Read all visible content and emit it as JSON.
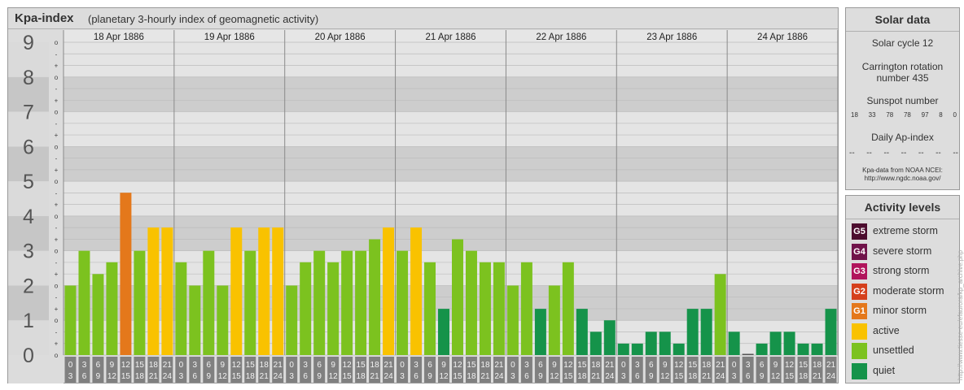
{
  "header": {
    "title": "Kpa-index",
    "subtitle": "(planetary 3-hourly index of geomagnetic activity)"
  },
  "chart_data": {
    "type": "bar",
    "title": "Kpa-index",
    "subtitle": "(planetary 3-hourly index of geomagnetic activity)",
    "ylim": [
      0,
      9
    ],
    "y_ticks": [
      "0",
      "1",
      "2",
      "3",
      "4",
      "5",
      "6",
      "7",
      "8",
      "9"
    ],
    "minor_tick_labels": [
      "o",
      "+",
      "-"
    ],
    "days": [
      "18 Apr 1886",
      "19 Apr 1886",
      "20 Apr 1886",
      "21 Apr 1886",
      "22 Apr 1886",
      "23 Apr 1886",
      "24 Apr 1886"
    ],
    "interval_start_labels": [
      "0",
      "3",
      "6",
      "9",
      "12",
      "15",
      "18",
      "21"
    ],
    "interval_end_labels": [
      "3",
      "6",
      "9",
      "12",
      "15",
      "18",
      "21",
      "24"
    ],
    "values": [
      [
        2.0,
        3.0,
        2.33,
        2.67,
        4.67,
        3.0,
        3.67,
        3.67
      ],
      [
        2.67,
        2.0,
        3.0,
        2.0,
        3.67,
        3.0,
        3.67,
        3.67
      ],
      [
        2.0,
        2.67,
        3.0,
        2.67,
        3.0,
        3.0,
        3.33,
        3.67
      ],
      [
        3.0,
        3.67,
        2.67,
        1.33,
        3.33,
        3.0,
        2.67,
        2.67
      ],
      [
        2.0,
        2.67,
        1.33,
        2.0,
        2.67,
        1.33,
        0.67,
        1.0
      ],
      [
        0.33,
        0.33,
        0.67,
        0.67,
        0.33,
        1.33,
        1.33,
        2.33
      ],
      [
        0.67,
        0.0,
        0.33,
        0.67,
        0.67,
        0.33,
        0.33,
        1.33
      ]
    ],
    "level_colors": {
      "quiet": "#15934a",
      "unsettled": "#7cc21f",
      "active": "#f9c200",
      "G1": "#e4781b",
      "G2": "#d5401c",
      "G3": "#b1145c",
      "G4": "#70134a",
      "G5": "#4c0c2e"
    }
  },
  "solar": {
    "heading": "Solar data",
    "cycle": "Solar cycle 12",
    "rotation_line1": "Carrington rotation",
    "rotation_line2": "number 435",
    "sunspot_label": "Sunspot number",
    "sunspot_values": [
      "18",
      "33",
      "78",
      "78",
      "97",
      "8",
      "0"
    ],
    "ap_label": "Daily Ap-index",
    "ap_values": [
      "--",
      "--",
      "--",
      "--",
      "--",
      "--",
      "--"
    ],
    "source_line1": "Kpa-data from NOAA NCEI:",
    "source_line2": "http://www.ngdc.noaa.gov/"
  },
  "legend": {
    "heading": "Activity levels",
    "items": [
      {
        "badge": "G5",
        "label": "extreme storm",
        "color": "#4c0c2e"
      },
      {
        "badge": "G4",
        "label": "severe storm",
        "color": "#70134a"
      },
      {
        "badge": "G3",
        "label": "strong storm",
        "color": "#b1145c"
      },
      {
        "badge": "G2",
        "label": "moderate storm",
        "color": "#d5401c"
      },
      {
        "badge": "G1",
        "label": "minor storm",
        "color": "#e4781b"
      },
      {
        "badge": "",
        "label": "active",
        "color": "#f9c200"
      },
      {
        "badge": "",
        "label": "unsettled",
        "color": "#7cc21f"
      },
      {
        "badge": "",
        "label": "quiet",
        "color": "#15934a"
      }
    ]
  },
  "watermark": "http://www.tiesse-eu/efaurora/kp_archive.php"
}
